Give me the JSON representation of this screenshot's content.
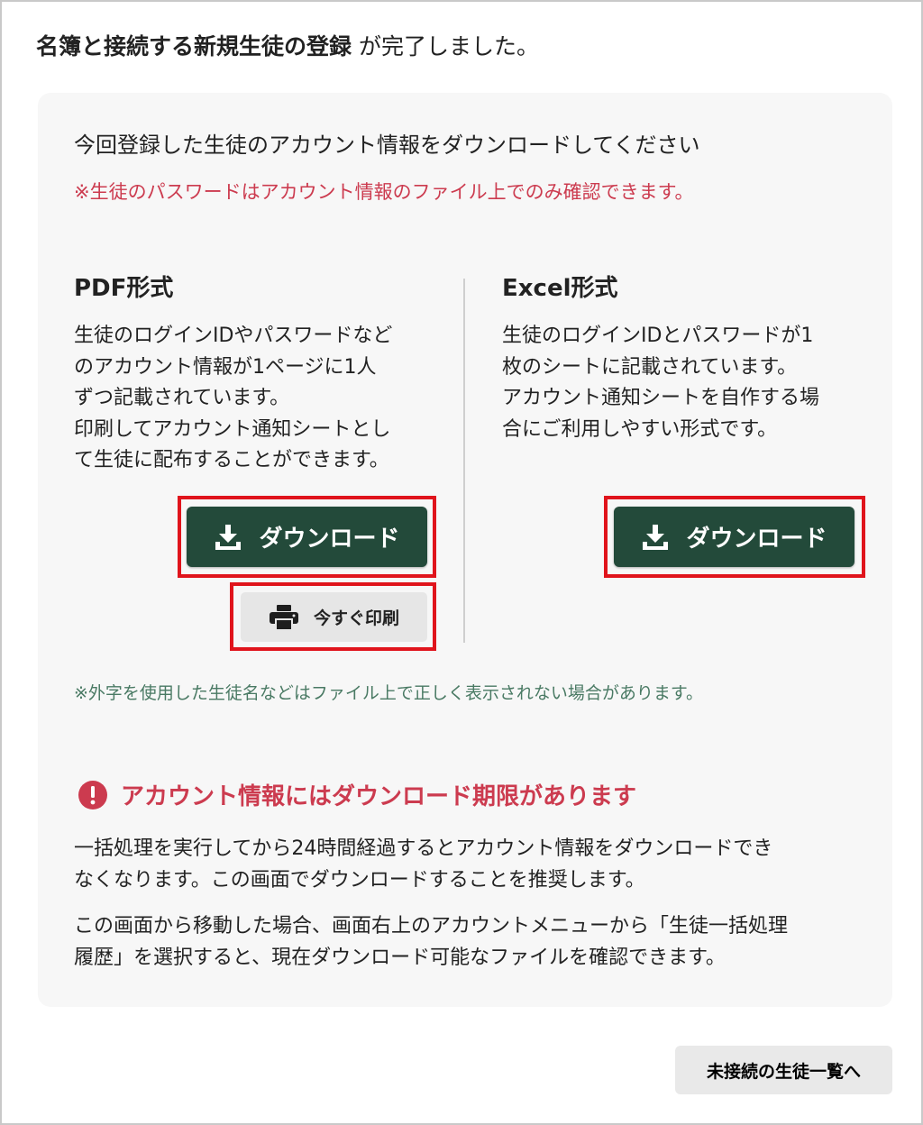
{
  "header": {
    "title_strong": "名簿と接続する新規生徒の登録",
    "title_rest": " が完了しました。"
  },
  "panel": {
    "intro": "今回登録した生徒のアカウント情報をダウンロードしてください",
    "password_notice": "※生徒のパスワードはアカウント情報のファイル上でのみ確認できます。",
    "pdf": {
      "title": "PDF形式",
      "desc_lines": [
        "生徒のログインIDやパスワードなど",
        "のアカウント情報が1ページに1人",
        "ずつ記載されています。",
        "印刷してアカウント通知シートとし",
        "て生徒に配布することができます。"
      ],
      "download_label": "ダウンロード",
      "print_label": "今すぐ印刷"
    },
    "excel": {
      "title": "Excel形式",
      "desc_lines": [
        "生徒のログインIDとパスワードが1",
        "枚のシートに記載されています。",
        "アカウント通知シートを自作する場",
        "合にご利用しやすい形式です。"
      ],
      "download_label": "ダウンロード"
    },
    "gaiji_note": "※外字を使用した生徒名などはファイル上で正しく表示されない場合があります。",
    "warning": {
      "heading": "アカウント情報にはダウンロード期限があります",
      "para1_lines": [
        "一括処理を実行してから24時間経過するとアカウント情報をダウンロードでき",
        "なくなります。この画面でダウンロードすることを推奨します。"
      ],
      "para2_lines": [
        "この画面から移動した場合、画面右上のアカウントメニューから「生徒一括処理",
        "履歴」を選択すると、現在ダウンロード可能なファイルを確認できます。"
      ]
    }
  },
  "footer": {
    "list_button_label": "未接続の生徒一覧へ"
  },
  "icons": {
    "download": "download-icon",
    "print": "printer-icon",
    "warning": "exclamation-circle-icon"
  },
  "colors": {
    "primary_button": "#234a3a",
    "notice_red": "#cc3b4f",
    "note_green": "#4a7a64",
    "highlight": "#e0141c",
    "panel_bg": "#f7f7f7"
  }
}
